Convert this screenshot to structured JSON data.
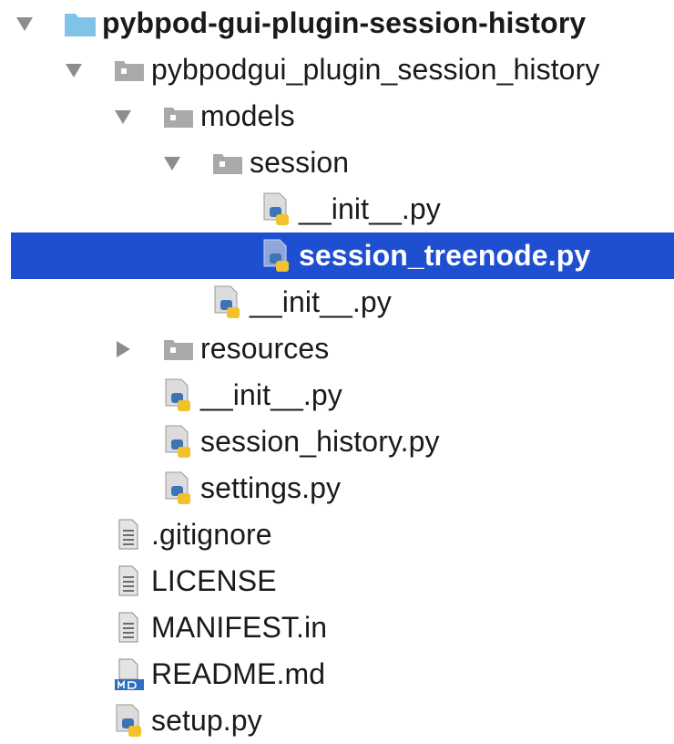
{
  "tree": {
    "root": "pybpod-gui-plugin-session-history",
    "items": [
      {
        "label": "pybpod-gui-plugin-session-history",
        "icon": "project-folder-icon",
        "expand": "down",
        "bold": true
      },
      {
        "label": "pybpodgui_plugin_session_history",
        "icon": "package-folder-icon",
        "expand": "down"
      },
      {
        "label": "models",
        "icon": "package-folder-icon",
        "expand": "down"
      },
      {
        "label": "session",
        "icon": "package-folder-icon",
        "expand": "down"
      },
      {
        "label": "__init__.py",
        "icon": "python-file-icon",
        "expand": "none"
      },
      {
        "label": "session_treenode.py",
        "icon": "python-file-icon",
        "expand": "none",
        "selected": true,
        "bold": true
      },
      {
        "label": "__init__.py",
        "icon": "python-file-icon",
        "expand": "none"
      },
      {
        "label": "resources",
        "icon": "package-folder-icon",
        "expand": "right"
      },
      {
        "label": "__init__.py",
        "icon": "python-file-icon",
        "expand": "none"
      },
      {
        "label": "session_history.py",
        "icon": "python-file-icon",
        "expand": "none"
      },
      {
        "label": "settings.py",
        "icon": "python-file-icon",
        "expand": "none"
      },
      {
        "label": ".gitignore",
        "icon": "text-file-icon",
        "expand": "none"
      },
      {
        "label": "LICENSE",
        "icon": "text-file-icon",
        "expand": "none"
      },
      {
        "label": "MANIFEST.in",
        "icon": "text-file-icon",
        "expand": "none"
      },
      {
        "label": "README.md",
        "icon": "markdown-file-icon",
        "expand": "none"
      },
      {
        "label": "setup.py",
        "icon": "python-file-icon",
        "expand": "none"
      }
    ],
    "colors": {
      "selection": "#1f4fd1",
      "folder": "#7fc4e8",
      "package_folder": "#9a9a9a",
      "python_blue": "#3d74b8",
      "python_yellow": "#f2c12e"
    }
  }
}
